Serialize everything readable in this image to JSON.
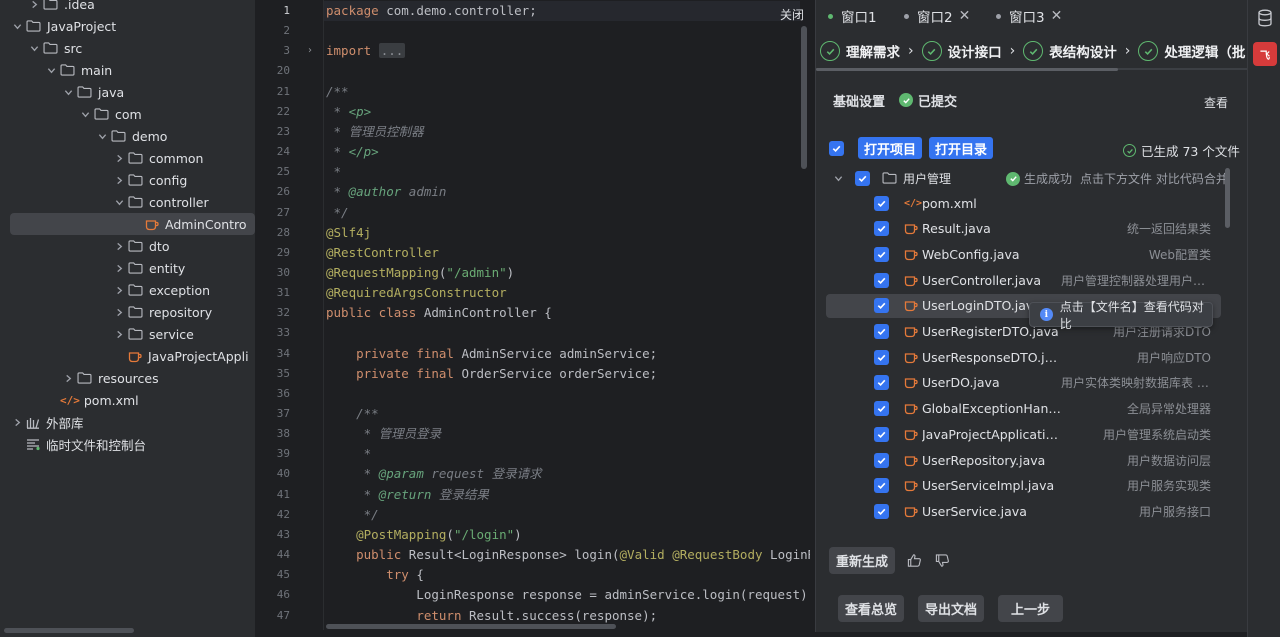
{
  "tree": {
    "items": [
      {
        "label": ".idea",
        "depth": 2,
        "kind": "folder",
        "expanded": false
      },
      {
        "label": "JavaProject",
        "depth": 1,
        "kind": "folder",
        "expanded": true
      },
      {
        "label": "src",
        "depth": 2,
        "kind": "folder",
        "expanded": true
      },
      {
        "label": "main",
        "depth": 3,
        "kind": "folder",
        "expanded": true
      },
      {
        "label": "java",
        "depth": 4,
        "kind": "folder",
        "expanded": true
      },
      {
        "label": "com",
        "depth": 5,
        "kind": "folder",
        "expanded": true
      },
      {
        "label": "demo",
        "depth": 6,
        "kind": "folder",
        "expanded": true
      },
      {
        "label": "common",
        "depth": 7,
        "kind": "folder",
        "expanded": false
      },
      {
        "label": "config",
        "depth": 7,
        "kind": "folder",
        "expanded": false
      },
      {
        "label": "controller",
        "depth": 7,
        "kind": "folder",
        "expanded": true
      },
      {
        "label": "AdminContro",
        "depth": 8,
        "kind": "java",
        "selected": true
      },
      {
        "label": "dto",
        "depth": 7,
        "kind": "folder",
        "expanded": false
      },
      {
        "label": "entity",
        "depth": 7,
        "kind": "folder",
        "expanded": false
      },
      {
        "label": "exception",
        "depth": 7,
        "kind": "folder",
        "expanded": false
      },
      {
        "label": "repository",
        "depth": 7,
        "kind": "folder",
        "expanded": false
      },
      {
        "label": "service",
        "depth": 7,
        "kind": "folder",
        "expanded": false
      },
      {
        "label": "JavaProjectAppli",
        "depth": 7,
        "kind": "java"
      },
      {
        "label": "resources",
        "depth": 4,
        "kind": "folder",
        "expanded": false
      },
      {
        "label": "pom.xml",
        "depth": 3,
        "kind": "xml"
      },
      {
        "label": "外部库",
        "depth": 1,
        "kind": "library",
        "expanded": false
      },
      {
        "label": "临时文件和控制台",
        "depth": 1,
        "kind": "scratch"
      }
    ]
  },
  "editor": {
    "close_label": "关闭",
    "lines": [
      {
        "n": "1",
        "tokens": [
          [
            "kw",
            "package"
          ],
          [
            "",
            " com.demo.controller;"
          ]
        ],
        "current": true
      },
      {
        "n": "2",
        "tokens": []
      },
      {
        "n": "3",
        "tokens": [
          [
            "kw",
            "import"
          ],
          [
            "",
            " "
          ],
          [
            "dot3",
            "..."
          ]
        ],
        "fold": true
      },
      {
        "n": "20",
        "tokens": []
      },
      {
        "n": "21",
        "tokens": [
          [
            "cm",
            "/**"
          ]
        ]
      },
      {
        "n": "22",
        "tokens": [
          [
            "cm",
            " * "
          ],
          [
            "cmtag",
            "<p>"
          ]
        ]
      },
      {
        "n": "23",
        "tokens": [
          [
            "cm",
            " * 管理员控制器"
          ]
        ]
      },
      {
        "n": "24",
        "tokens": [
          [
            "cm",
            " * "
          ],
          [
            "cmtag",
            "</p>"
          ]
        ]
      },
      {
        "n": "25",
        "tokens": [
          [
            "cm",
            " *"
          ]
        ]
      },
      {
        "n": "26",
        "tokens": [
          [
            "cm",
            " * "
          ],
          [
            "cmtag",
            "@author"
          ],
          [
            "cm",
            " admin"
          ]
        ]
      },
      {
        "n": "27",
        "tokens": [
          [
            "cm",
            " */"
          ]
        ]
      },
      {
        "n": "28",
        "tokens": [
          [
            "an",
            "@Slf4j"
          ]
        ]
      },
      {
        "n": "29",
        "tokens": [
          [
            "an",
            "@RestController"
          ]
        ]
      },
      {
        "n": "30",
        "tokens": [
          [
            "an",
            "@RequestMapping"
          ],
          [
            "",
            "("
          ],
          [
            "st",
            "\"/admin\""
          ],
          [
            "",
            ")"
          ]
        ]
      },
      {
        "n": "31",
        "tokens": [
          [
            "an",
            "@RequiredArgsConstructor"
          ]
        ]
      },
      {
        "n": "32",
        "tokens": [
          [
            "kw",
            "public class"
          ],
          [
            "",
            " AdminController {"
          ]
        ]
      },
      {
        "n": "33",
        "tokens": []
      },
      {
        "n": "34",
        "tokens": [
          [
            "",
            "    "
          ],
          [
            "kw",
            "private final"
          ],
          [
            "",
            " AdminService adminService;"
          ]
        ]
      },
      {
        "n": "35",
        "tokens": [
          [
            "",
            "    "
          ],
          [
            "kw",
            "private final"
          ],
          [
            "",
            " OrderService orderService;"
          ]
        ]
      },
      {
        "n": "36",
        "tokens": []
      },
      {
        "n": "37",
        "tokens": [
          [
            "cm",
            "    /**"
          ]
        ]
      },
      {
        "n": "38",
        "tokens": [
          [
            "cm",
            "     * 管理员登录"
          ]
        ]
      },
      {
        "n": "39",
        "tokens": [
          [
            "cm",
            "     *"
          ]
        ]
      },
      {
        "n": "40",
        "tokens": [
          [
            "cm",
            "     * "
          ],
          [
            "cmtag",
            "@param"
          ],
          [
            "cm",
            " request 登录请求"
          ]
        ]
      },
      {
        "n": "41",
        "tokens": [
          [
            "cm",
            "     * "
          ],
          [
            "cmtag",
            "@return"
          ],
          [
            "cm",
            " 登录结果"
          ]
        ]
      },
      {
        "n": "42",
        "tokens": [
          [
            "cm",
            "     */"
          ]
        ]
      },
      {
        "n": "43",
        "tokens": [
          [
            "",
            "    "
          ],
          [
            "an",
            "@PostMapping"
          ],
          [
            "",
            "("
          ],
          [
            "st",
            "\"/login\""
          ],
          [
            "",
            ")"
          ]
        ]
      },
      {
        "n": "44",
        "tokens": [
          [
            "",
            "    "
          ],
          [
            "kw",
            "public"
          ],
          [
            "",
            " Result<LoginResponse> login("
          ],
          [
            "an",
            "@Valid @RequestBody"
          ],
          [
            "",
            " LoginRe"
          ]
        ]
      },
      {
        "n": "45",
        "tokens": [
          [
            "",
            "        "
          ],
          [
            "kw",
            "try"
          ],
          [
            "",
            " {"
          ]
        ]
      },
      {
        "n": "46",
        "tokens": [
          [
            "",
            "            LoginResponse response = adminService.login(request);"
          ]
        ]
      },
      {
        "n": "47",
        "tokens": [
          [
            "",
            "            "
          ],
          [
            "kw",
            "return"
          ],
          [
            "",
            " Result.success(response);"
          ]
        ]
      }
    ]
  },
  "panel": {
    "tabs": [
      {
        "label": "窗口1",
        "dot_color": "#5fb870",
        "closable": false
      },
      {
        "label": "窗口2",
        "dot_color": "#9da0a8",
        "closable": true
      },
      {
        "label": "窗口3",
        "dot_color": "#9da0a8",
        "closable": true
      }
    ],
    "steps": [
      "理解需求",
      "设计接口",
      "表结构设计",
      "处理逻辑（批"
    ],
    "base_title": "基础设置",
    "submitted": "已提交",
    "view_label": "查看",
    "open_project": "打开项目",
    "open_dir": "打开目录",
    "generated_count": "已生成 73 个文件",
    "group": {
      "label": "用户管理",
      "status": "生成成功",
      "hint": "点击下方文件 对比代码合并"
    },
    "files": [
      {
        "name": "pom.xml",
        "desc": "",
        "kind": "xml"
      },
      {
        "name": "Result.java",
        "desc": "统一返回结果类",
        "kind": "java"
      },
      {
        "name": "WebConfig.java",
        "desc": "Web配置类",
        "kind": "java"
      },
      {
        "name": "UserController.java",
        "desc": "用户管理控制器处理用户注...",
        "kind": "java"
      },
      {
        "name": "UserLoginDTO.java",
        "desc": "",
        "kind": "java",
        "highlight": true
      },
      {
        "name": "UserRegisterDTO.java",
        "desc": "用户注册请求DTO",
        "kind": "java"
      },
      {
        "name": "UserResponseDTO.java",
        "desc": "用户响应DTO",
        "kind": "java"
      },
      {
        "name": "UserDO.java",
        "desc": "用户实体类映射数据库表 t...",
        "kind": "java"
      },
      {
        "name": "GlobalExceptionHandler...",
        "desc": "全局异常处理器",
        "kind": "java"
      },
      {
        "name": "JavaProjectApplication...",
        "desc": "用户管理系统启动类",
        "kind": "java"
      },
      {
        "name": "UserRepository.java",
        "desc": "用户数据访问层",
        "kind": "java"
      },
      {
        "name": "UserServiceImpl.java",
        "desc": "用户服务实现类",
        "kind": "java"
      },
      {
        "name": "UserService.java",
        "desc": "用户服务接口",
        "kind": "java"
      }
    ],
    "tooltip": "点击【文件名】查看代码对比",
    "regen": "重新生成",
    "bottom_buttons": [
      "查看总览",
      "导出文档",
      "上一步"
    ]
  },
  "strip": {
    "feishu_label": "飞"
  },
  "colors": {
    "accent": "#3574f0",
    "success": "#5fb870",
    "keyword": "#cf8e6d",
    "annotation": "#b3ae60",
    "string": "#6aab73",
    "comment": "#7a7e85"
  }
}
